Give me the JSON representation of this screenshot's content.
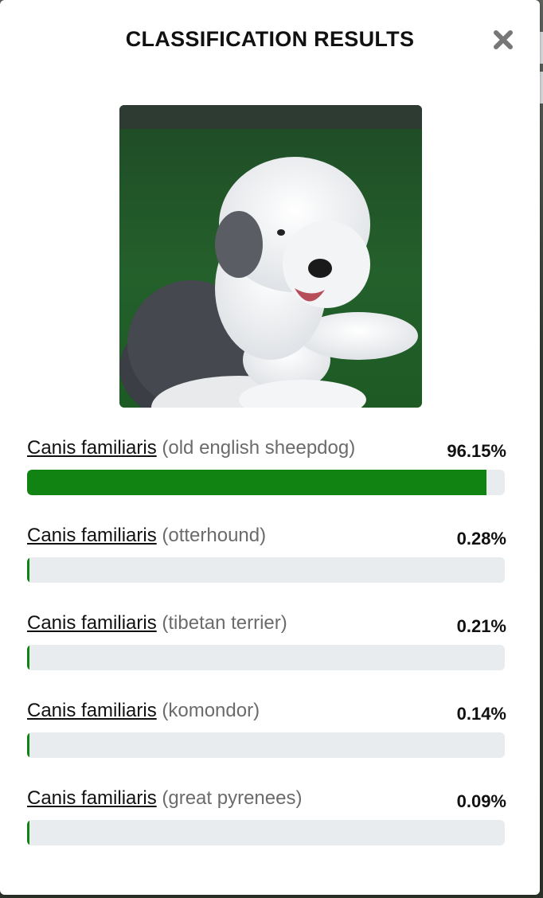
{
  "modal": {
    "title": "CLASSIFICATION RESULTS",
    "close_icon": "close-icon"
  },
  "image": {
    "subject": "old english sheepdog lying on grass"
  },
  "colors": {
    "bar_fill": "#108312",
    "bar_track": "#e9ecef",
    "common_name": "#6b6b6b"
  },
  "results": [
    {
      "scientific": "Canis familiaris",
      "common": "(old english sheepdog)",
      "percent": "96.15%",
      "value": 96.15
    },
    {
      "scientific": "Canis familiaris",
      "common": "(otterhound)",
      "percent": "0.28%",
      "value": 0.28
    },
    {
      "scientific": "Canis familiaris",
      "common": "(tibetan terrier)",
      "percent": "0.21%",
      "value": 0.21
    },
    {
      "scientific": "Canis familiaris",
      "common": "(komondor)",
      "percent": "0.14%",
      "value": 0.14
    },
    {
      "scientific": "Canis familiaris",
      "common": "(great pyrenees)",
      "percent": "0.09%",
      "value": 0.09
    }
  ]
}
